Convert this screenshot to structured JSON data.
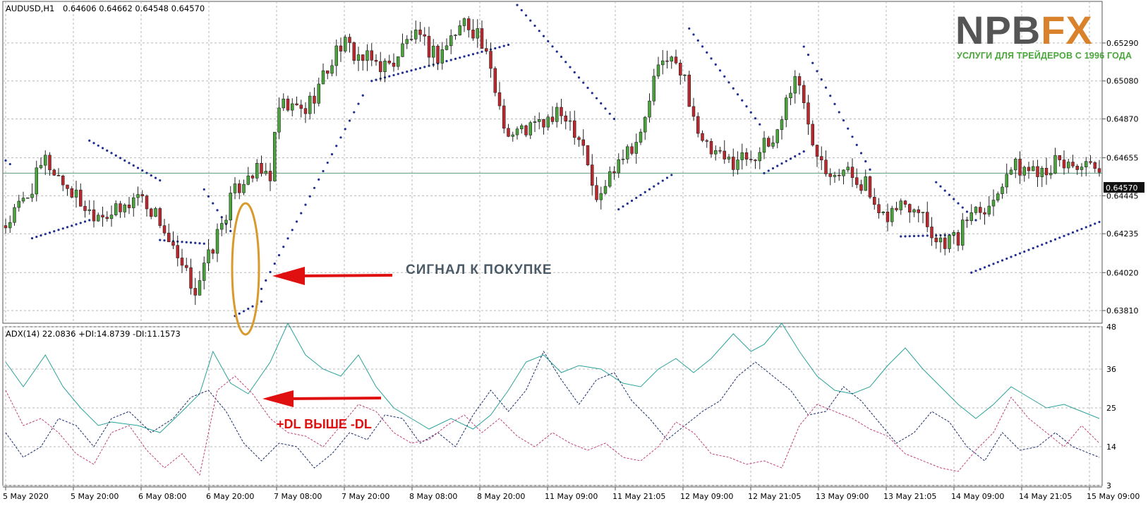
{
  "main_header": {
    "symbol": "AUDUSD,H1",
    "ohlc": "0.64606 0.64662 0.64548 0.64570"
  },
  "indicator_header": {
    "text": "ADX(14) 22.0836 +DI:14.8739 -DI:11.1573"
  },
  "logo": {
    "word_main": "NPB",
    "word_accent": "FX",
    "tagline": "УСЛУГИ ДЛЯ ТРЕЙДЕРОВ С 1996 ГОДА"
  },
  "annotations": {
    "buy_signal": "СИГНАЛ К ПОКУПКЕ",
    "di_cross": "+DL ВЫШЕ -DL"
  },
  "colors": {
    "bull": "#4aa63b",
    "bear": "#c0272d",
    "sar": "#1f2f8f",
    "adx": "#2aa39a",
    "plus_di": "#1a2a6c",
    "minus_di": "#c0407a",
    "arrow": "#e01010",
    "ellipse": "#d99a2b",
    "grid": "#b8b8b8",
    "price_line": "#5a9a7a"
  },
  "chart_data": [
    {
      "type": "candlestick",
      "title": "AUDUSD,H1",
      "ylim": [
        0.6374,
        0.6552
      ],
      "y_ticks": [
        "0.63810",
        "0.64020",
        "0.64235",
        "0.64445",
        "0.64655",
        "0.64870",
        "0.65080",
        "0.65290"
      ],
      "current_price": "0.64570",
      "x_ticks": [
        "5 May 2020",
        "5 May 20:00",
        "6 May 08:00",
        "6 May 20:00",
        "7 May 08:00",
        "7 May 20:00",
        "8 May 08:00",
        "8 May 20:00",
        "11 May 09:00",
        "11 May 21:05",
        "12 May 09:00",
        "12 May 21:05",
        "13 May 09:00",
        "13 May 21:05",
        "14 May 09:00",
        "14 May 21:05",
        "15 May 09:00"
      ],
      "close_path": [
        [
          0,
          0.6428
        ],
        [
          5,
          0.6445
        ],
        [
          9,
          0.6464
        ],
        [
          13,
          0.6452
        ],
        [
          19,
          0.6436
        ],
        [
          26,
          0.6435
        ],
        [
          30,
          0.6446
        ],
        [
          35,
          0.6431
        ],
        [
          39,
          0.6407
        ],
        [
          43,
          0.6393
        ],
        [
          46,
          0.641
        ],
        [
          51,
          0.6442
        ],
        [
          55,
          0.6458
        ],
        [
          60,
          0.6456
        ],
        [
          62,
          0.6493
        ],
        [
          68,
          0.6492
        ],
        [
          72,
          0.651
        ],
        [
          76,
          0.6529
        ],
        [
          81,
          0.652
        ],
        [
          87,
          0.6516
        ],
        [
          92,
          0.6533
        ],
        [
          98,
          0.6522
        ],
        [
          104,
          0.6541
        ],
        [
          107,
          0.6535
        ],
        [
          110,
          0.6512
        ],
        [
          114,
          0.6478
        ],
        [
          120,
          0.6483
        ],
        [
          127,
          0.649
        ],
        [
          131,
          0.6474
        ],
        [
          134,
          0.644
        ],
        [
          139,
          0.6467
        ],
        [
          144,
          0.6477
        ],
        [
          147,
          0.6508
        ],
        [
          150,
          0.6523
        ],
        [
          154,
          0.6508
        ],
        [
          158,
          0.6472
        ],
        [
          163,
          0.6463
        ],
        [
          170,
          0.6468
        ],
        [
          174,
          0.6474
        ],
        [
          179,
          0.6512
        ],
        [
          183,
          0.6477
        ],
        [
          186,
          0.6461
        ],
        [
          191,
          0.6457
        ],
        [
          195,
          0.6451
        ],
        [
          198,
          0.643
        ],
        [
          203,
          0.644
        ],
        [
          207,
          0.644
        ],
        [
          211,
          0.642
        ],
        [
          216,
          0.6421
        ],
        [
          219,
          0.6438
        ],
        [
          224,
          0.6441
        ],
        [
          227,
          0.646
        ],
        [
          232,
          0.6459
        ],
        [
          238,
          0.6462
        ],
        [
          243,
          0.6462
        ],
        [
          247,
          0.6457
        ]
      ],
      "sar_segments": [
        {
          "from": 0,
          "to": 1,
          "start": 0.6464,
          "end": 0.6462
        },
        {
          "from": 6,
          "to": 19,
          "start": 0.6421,
          "end": 0.6431
        },
        {
          "from": 19,
          "to": 35,
          "start": 0.6475,
          "end": 0.6453
        },
        {
          "from": 35,
          "to": 45,
          "start": 0.642,
          "end": 0.6418
        },
        {
          "from": 45,
          "to": 51,
          "start": 0.6448,
          "end": 0.6425
        },
        {
          "from": 52,
          "to": 58,
          "start": 0.6378,
          "end": 0.6386
        },
        {
          "from": 58,
          "to": 81,
          "start": 0.6393,
          "end": 0.65
        },
        {
          "from": 83,
          "to": 114,
          "start": 0.6508,
          "end": 0.6528
        },
        {
          "from": 116,
          "to": 138,
          "start": 0.655,
          "end": 0.6487
        },
        {
          "from": 139,
          "to": 151,
          "start": 0.6437,
          "end": 0.6456
        },
        {
          "from": 155,
          "to": 171,
          "start": 0.6537,
          "end": 0.6484
        },
        {
          "from": 172,
          "to": 181,
          "start": 0.6457,
          "end": 0.6469
        },
        {
          "from": 181,
          "to": 196,
          "start": 0.6527,
          "end": 0.6459
        },
        {
          "from": 203,
          "to": 217,
          "start": 0.6422,
          "end": 0.6423
        },
        {
          "from": 211,
          "to": 220,
          "start": 0.6452,
          "end": 0.6431
        },
        {
          "from": 219,
          "to": 248,
          "start": 0.6402,
          "end": 0.643
        }
      ]
    },
    {
      "type": "line",
      "title": "ADX(14) 22.0836 +DI:14.8739 -DI:11.1573",
      "ylim": [
        3,
        48
      ],
      "y_ticks": [
        "3",
        "14",
        "25",
        "36",
        "48"
      ],
      "series": [
        {
          "name": "ADX",
          "style": "solid",
          "values": [
            [
              0,
              38
            ],
            [
              4,
              31
            ],
            [
              9,
              40
            ],
            [
              13,
              31
            ],
            [
              17,
              25
            ],
            [
              21,
              20
            ],
            [
              24,
              21
            ],
            [
              30,
              20
            ],
            [
              35,
              18
            ],
            [
              40,
              24
            ],
            [
              44,
              29
            ],
            [
              47,
              41
            ],
            [
              51,
              32
            ],
            [
              55,
              29
            ],
            [
              60,
              38
            ],
            [
              64,
              49
            ],
            [
              68,
              40
            ],
            [
              72,
              36
            ],
            [
              76,
              34
            ],
            [
              80,
              40
            ],
            [
              84,
              31
            ],
            [
              88,
              25
            ],
            [
              92,
              22
            ],
            [
              96,
              19
            ],
            [
              101,
              22
            ],
            [
              106,
              19
            ],
            [
              110,
              23
            ],
            [
              114,
              30
            ],
            [
              118,
              38
            ],
            [
              122,
              40
            ],
            [
              126,
              35
            ],
            [
              130,
              37
            ],
            [
              135,
              36
            ],
            [
              140,
              32
            ],
            [
              144,
              31
            ],
            [
              148,
              36
            ],
            [
              152,
              39
            ],
            [
              156,
              35
            ],
            [
              160,
              39
            ],
            [
              165,
              46
            ],
            [
              169,
              41
            ],
            [
              172,
              43
            ],
            [
              176,
              49
            ],
            [
              180,
              41
            ],
            [
              184,
              34
            ],
            [
              188,
              30
            ],
            [
              192,
              29
            ],
            [
              196,
              31
            ],
            [
              200,
              37
            ],
            [
              204,
              42
            ],
            [
              208,
              36
            ],
            [
              212,
              31
            ],
            [
              216,
              26
            ],
            [
              220,
              22
            ],
            [
              224,
              26
            ],
            [
              228,
              31
            ],
            [
              232,
              28
            ],
            [
              236,
              25
            ],
            [
              240,
              26
            ],
            [
              244,
              24
            ],
            [
              248,
              22
            ]
          ]
        },
        {
          "name": "+DI",
          "style": "dashed",
          "values": [
            [
              0,
              18
            ],
            [
              4,
              11
            ],
            [
              8,
              14
            ],
            [
              12,
              22
            ],
            [
              16,
              20
            ],
            [
              20,
              14
            ],
            [
              24,
              22
            ],
            [
              28,
              24
            ],
            [
              33,
              18
            ],
            [
              38,
              22
            ],
            [
              42,
              28
            ],
            [
              46,
              30
            ],
            [
              50,
              24
            ],
            [
              54,
              15
            ],
            [
              58,
              10
            ],
            [
              62,
              15
            ],
            [
              66,
              14
            ],
            [
              70,
              8
            ],
            [
              74,
              12
            ],
            [
              78,
              18
            ],
            [
              82,
              16
            ],
            [
              86,
              23
            ],
            [
              90,
              22
            ],
            [
              94,
              15
            ],
            [
              98,
              18
            ],
            [
              102,
              14
            ],
            [
              106,
              23
            ],
            [
              110,
              30
            ],
            [
              114,
              24
            ],
            [
              118,
              30
            ],
            [
              122,
              41
            ],
            [
              126,
              33
            ],
            [
              130,
              26
            ],
            [
              134,
              33
            ],
            [
              138,
              35
            ],
            [
              142,
              27
            ],
            [
              146,
              22
            ],
            [
              150,
              16
            ],
            [
              154,
              20
            ],
            [
              158,
              24
            ],
            [
              162,
              27
            ],
            [
              166,
              34
            ],
            [
              170,
              38
            ],
            [
              174,
              34
            ],
            [
              178,
              30
            ],
            [
              182,
              23
            ],
            [
              186,
              24
            ],
            [
              190,
              31
            ],
            [
              194,
              27
            ],
            [
              198,
              21
            ],
            [
              202,
              15
            ],
            [
              206,
              18
            ],
            [
              210,
              24
            ],
            [
              214,
              21
            ],
            [
              218,
              14
            ],
            [
              222,
              10
            ],
            [
              226,
              18
            ],
            [
              230,
              13
            ],
            [
              234,
              14
            ],
            [
              238,
              18
            ],
            [
              242,
              14
            ],
            [
              248,
              11
            ]
          ]
        },
        {
          "name": "-DI",
          "style": "dashed",
          "values": [
            [
              0,
              30
            ],
            [
              4,
              20
            ],
            [
              8,
              22
            ],
            [
              12,
              18
            ],
            [
              16,
              12
            ],
            [
              20,
              9
            ],
            [
              24,
              18
            ],
            [
              28,
              20
            ],
            [
              32,
              13
            ],
            [
              36,
              8
            ],
            [
              40,
              12
            ],
            [
              44,
              6
            ],
            [
              48,
              30
            ],
            [
              52,
              34
            ],
            [
              56,
              29
            ],
            [
              60,
              22
            ],
            [
              64,
              18
            ],
            [
              68,
              17
            ],
            [
              72,
              14
            ],
            [
              76,
              20
            ],
            [
              80,
              26
            ],
            [
              84,
              24
            ],
            [
              88,
              18
            ],
            [
              92,
              15
            ],
            [
              96,
              16
            ],
            [
              100,
              20
            ],
            [
              104,
              23
            ],
            [
              108,
              18
            ],
            [
              112,
              22
            ],
            [
              116,
              17
            ],
            [
              120,
              14
            ],
            [
              124,
              18
            ],
            [
              128,
              15
            ],
            [
              132,
              13
            ],
            [
              136,
              15
            ],
            [
              140,
              11
            ],
            [
              144,
              10
            ],
            [
              148,
              14
            ],
            [
              152,
              21
            ],
            [
              156,
              18
            ],
            [
              160,
              12
            ],
            [
              164,
              11
            ],
            [
              168,
              9
            ],
            [
              172,
              10
            ],
            [
              176,
              8
            ],
            [
              180,
              20
            ],
            [
              184,
              26
            ],
            [
              188,
              24
            ],
            [
              192,
              22
            ],
            [
              196,
              19
            ],
            [
              200,
              17
            ],
            [
              204,
              12
            ],
            [
              208,
              10
            ],
            [
              212,
              8
            ],
            [
              216,
              7
            ],
            [
              220,
              13
            ],
            [
              224,
              18
            ],
            [
              228,
              28
            ],
            [
              232,
              22
            ],
            [
              236,
              18
            ],
            [
              240,
              14
            ],
            [
              244,
              20
            ],
            [
              248,
              15
            ]
          ]
        }
      ]
    }
  ]
}
